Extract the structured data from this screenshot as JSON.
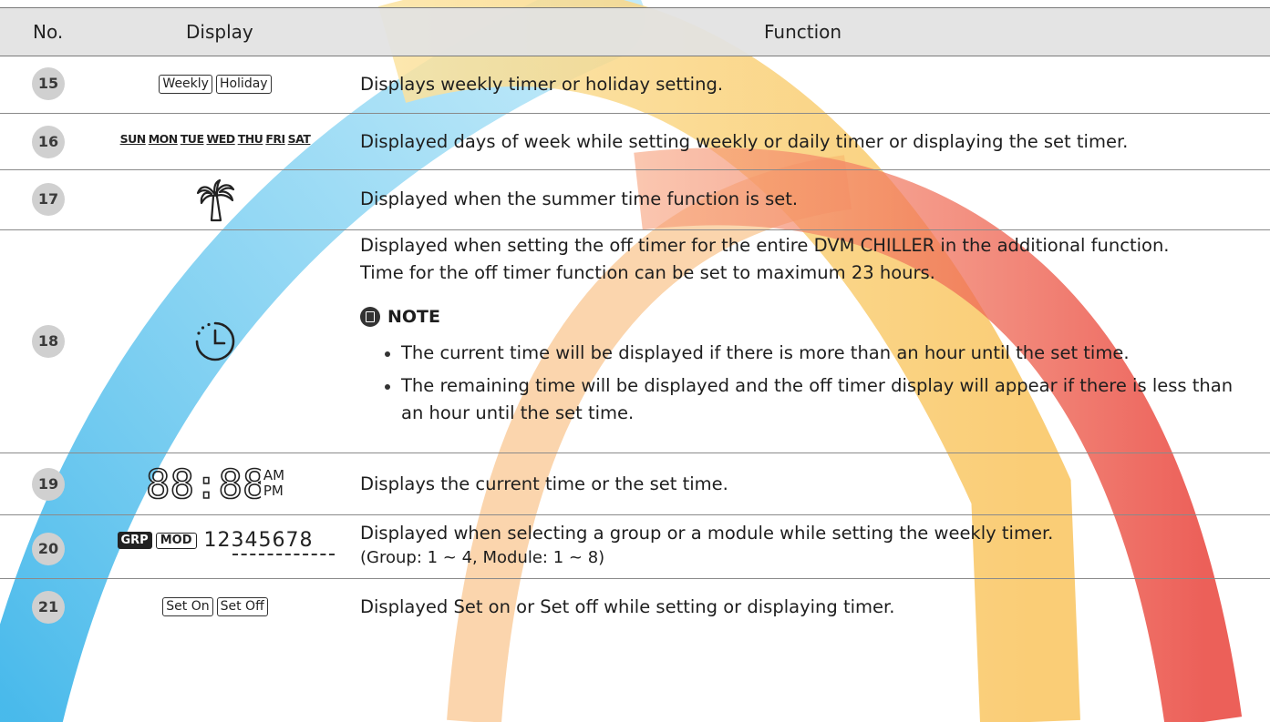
{
  "header": {
    "no": "No.",
    "display": "Display",
    "function": "Function"
  },
  "rows": [
    {
      "no": "15",
      "display": {
        "box1": "Weekly",
        "box2": "Holiday"
      },
      "function": "Displays weekly timer or holiday setting."
    },
    {
      "no": "16",
      "display": {
        "days": [
          "SUN",
          "MON",
          "TUE",
          "WED",
          "THU",
          "FRI",
          "SAT"
        ]
      },
      "function": "Displayed days of week while setting weekly or daily timer or displaying the  set timer."
    },
    {
      "no": "17",
      "display": {
        "icon": "palm-tree-icon"
      },
      "function": "Displayed when the summer time function is set."
    },
    {
      "no": "18",
      "display": {
        "icon": "off-timer-icon"
      },
      "function_line1": "Displayed when setting the off timer for the entire DVM CHILLER in the additional function.",
      "function_line2": "Time for the off timer function can be set to maximum 23 hours.",
      "note_label": "NOTE",
      "note_icon": "note-document-icon",
      "notes": [
        "The current time will be displayed if there is more than an hour until the set time.",
        "The remaining time will be displayed and the off timer display will appear if there is less than an hour until the set time."
      ]
    },
    {
      "no": "19",
      "display": {
        "digits": "88:88",
        "am": "AM",
        "pm": "PM"
      },
      "function": "Displays the current time or the set time."
    },
    {
      "no": "20",
      "display": {
        "grp": "GRP",
        "mod": "MOD",
        "numbers": "12345678"
      },
      "function_line1": "Displayed when selecting a group or a module while setting the weekly timer.",
      "function_line2": "(Group: 1 ~ 4, Module: 1 ~ 8)"
    },
    {
      "no": "21",
      "display": {
        "box1": "Set On",
        "box2": "Set Off"
      },
      "function": "Displayed Set on or Set off while setting or displaying timer."
    }
  ],
  "colors": {
    "header_bg": "#e2e2e2",
    "rule": "#8a8a8a",
    "number_badge": "#d0d0d0",
    "arc_blue": "#5ec4ee",
    "arc_yellow": "#fbd77a",
    "arc_orange": "#f6a35a",
    "arc_red": "#ec5248"
  }
}
